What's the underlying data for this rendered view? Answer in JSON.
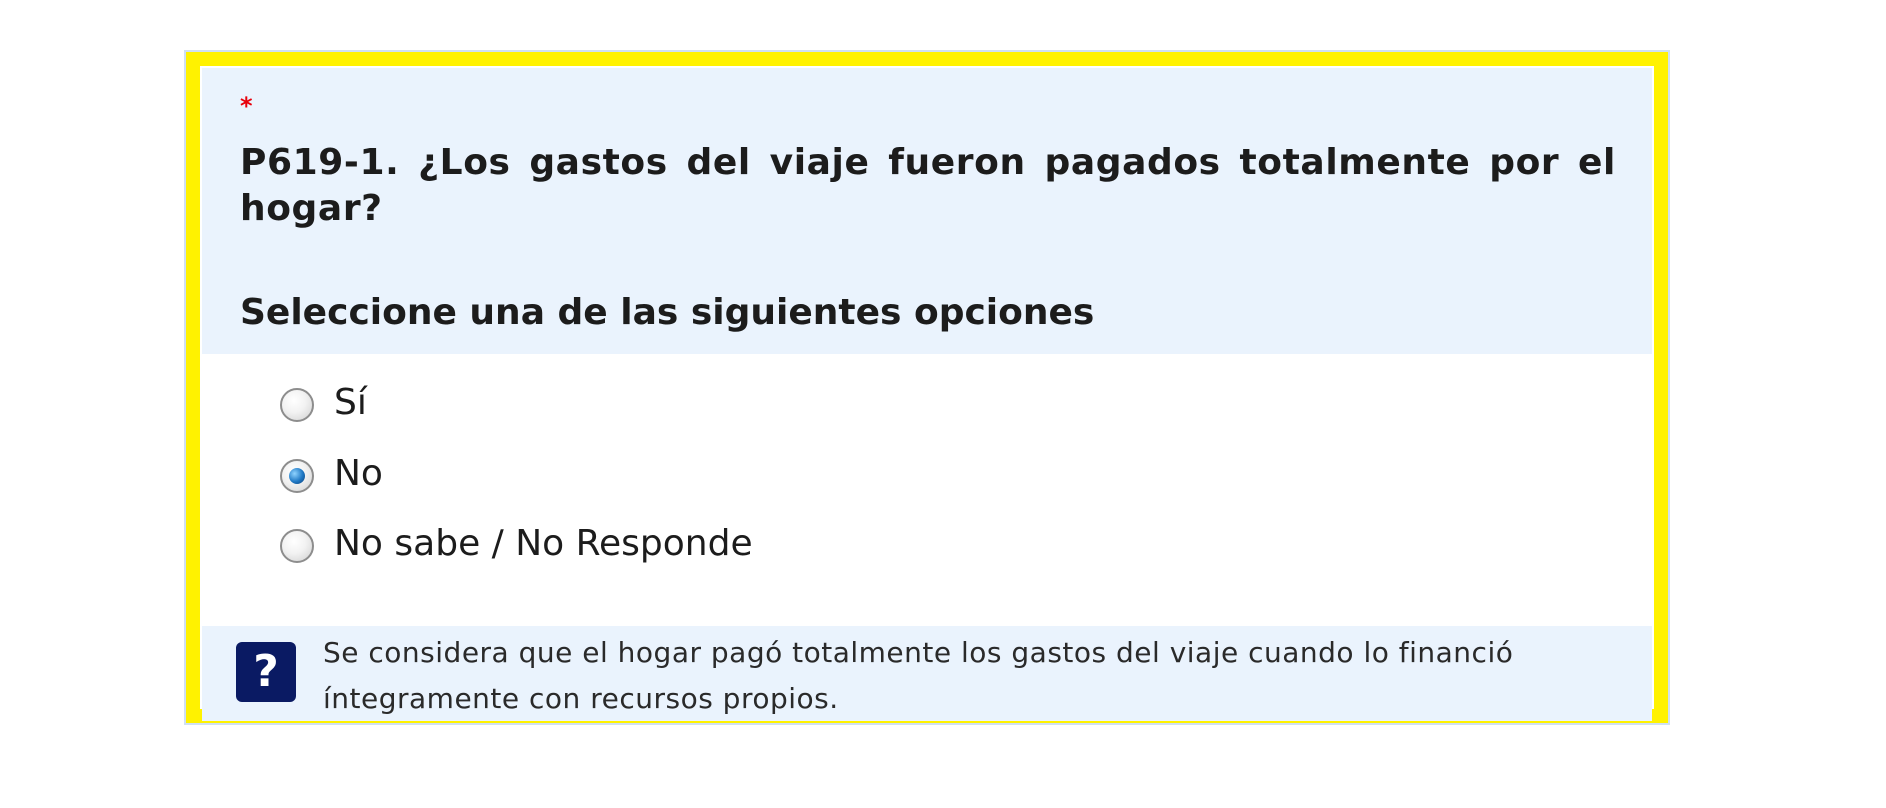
{
  "question": {
    "mandatory_mark": "*",
    "text": "P619-1. ¿Los gastos del viaje fueron pagados totalmente por el hogar?",
    "instruction": "Seleccione una de las siguientes opciones"
  },
  "options": [
    {
      "label": "Sí",
      "selected": false
    },
    {
      "label": "No",
      "selected": true
    },
    {
      "label": "No sabe / No Responde",
      "selected": false
    }
  ],
  "help": {
    "icon": "question-mark-icon",
    "icon_glyph": "?",
    "text": "Se considera que el hogar pagó totalmente los gastos del viaje cuando lo financió íntegramente con recursos propios."
  },
  "colors": {
    "frame_highlight": "#fff200",
    "header_background": "#eaf3fd",
    "mandatory": "#e8000b",
    "help_icon_background": "#0a1a63"
  }
}
